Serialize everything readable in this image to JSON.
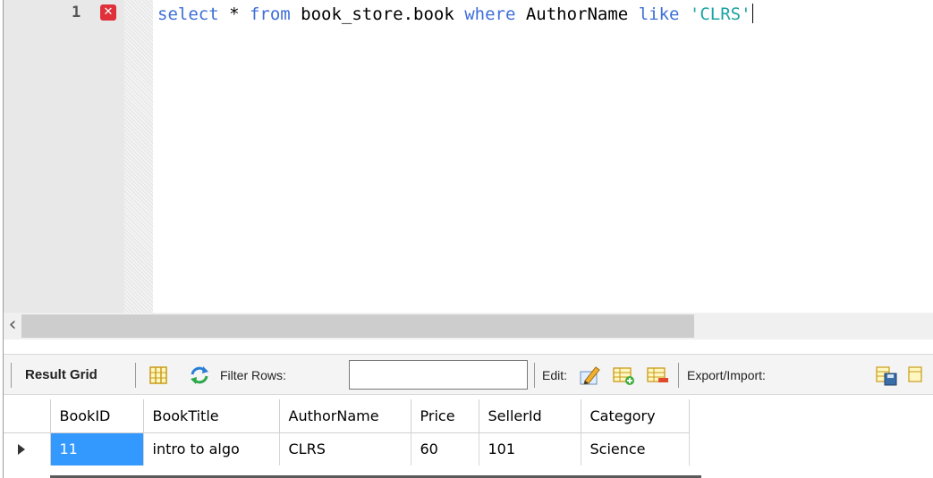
{
  "editor": {
    "line_number": "1",
    "error_icon": "error-x-icon",
    "code_tokens": {
      "select": "select",
      "star": " * ",
      "from": "from",
      "table": " book_store.book ",
      "where": "where",
      "column": " AuthorName ",
      "like": "like",
      "value": "'CLRS'"
    }
  },
  "toolbar": {
    "result_grid_label": "Result Grid",
    "filter_rows_label": "Filter Rows:",
    "filter_rows_value": "",
    "edit_label": "Edit:",
    "export_import_label": "Export/Import:",
    "icons": [
      "grid-layout-icon",
      "refresh-icon",
      "edit-pencil-icon",
      "add-row-icon",
      "delete-row-icon",
      "export-icon"
    ]
  },
  "result_grid": {
    "columns": [
      "BookID",
      "BookTitle",
      "AuthorName",
      "Price",
      "SellerId",
      "Category"
    ],
    "rows": [
      [
        "11",
        "intro to algo",
        "CLRS",
        "60",
        "101",
        "Science"
      ]
    ]
  },
  "colors": {
    "keyword": "#3f6fd8",
    "string": "#1aa3a3",
    "selection": "#3399ff",
    "error": "#e0303a"
  }
}
